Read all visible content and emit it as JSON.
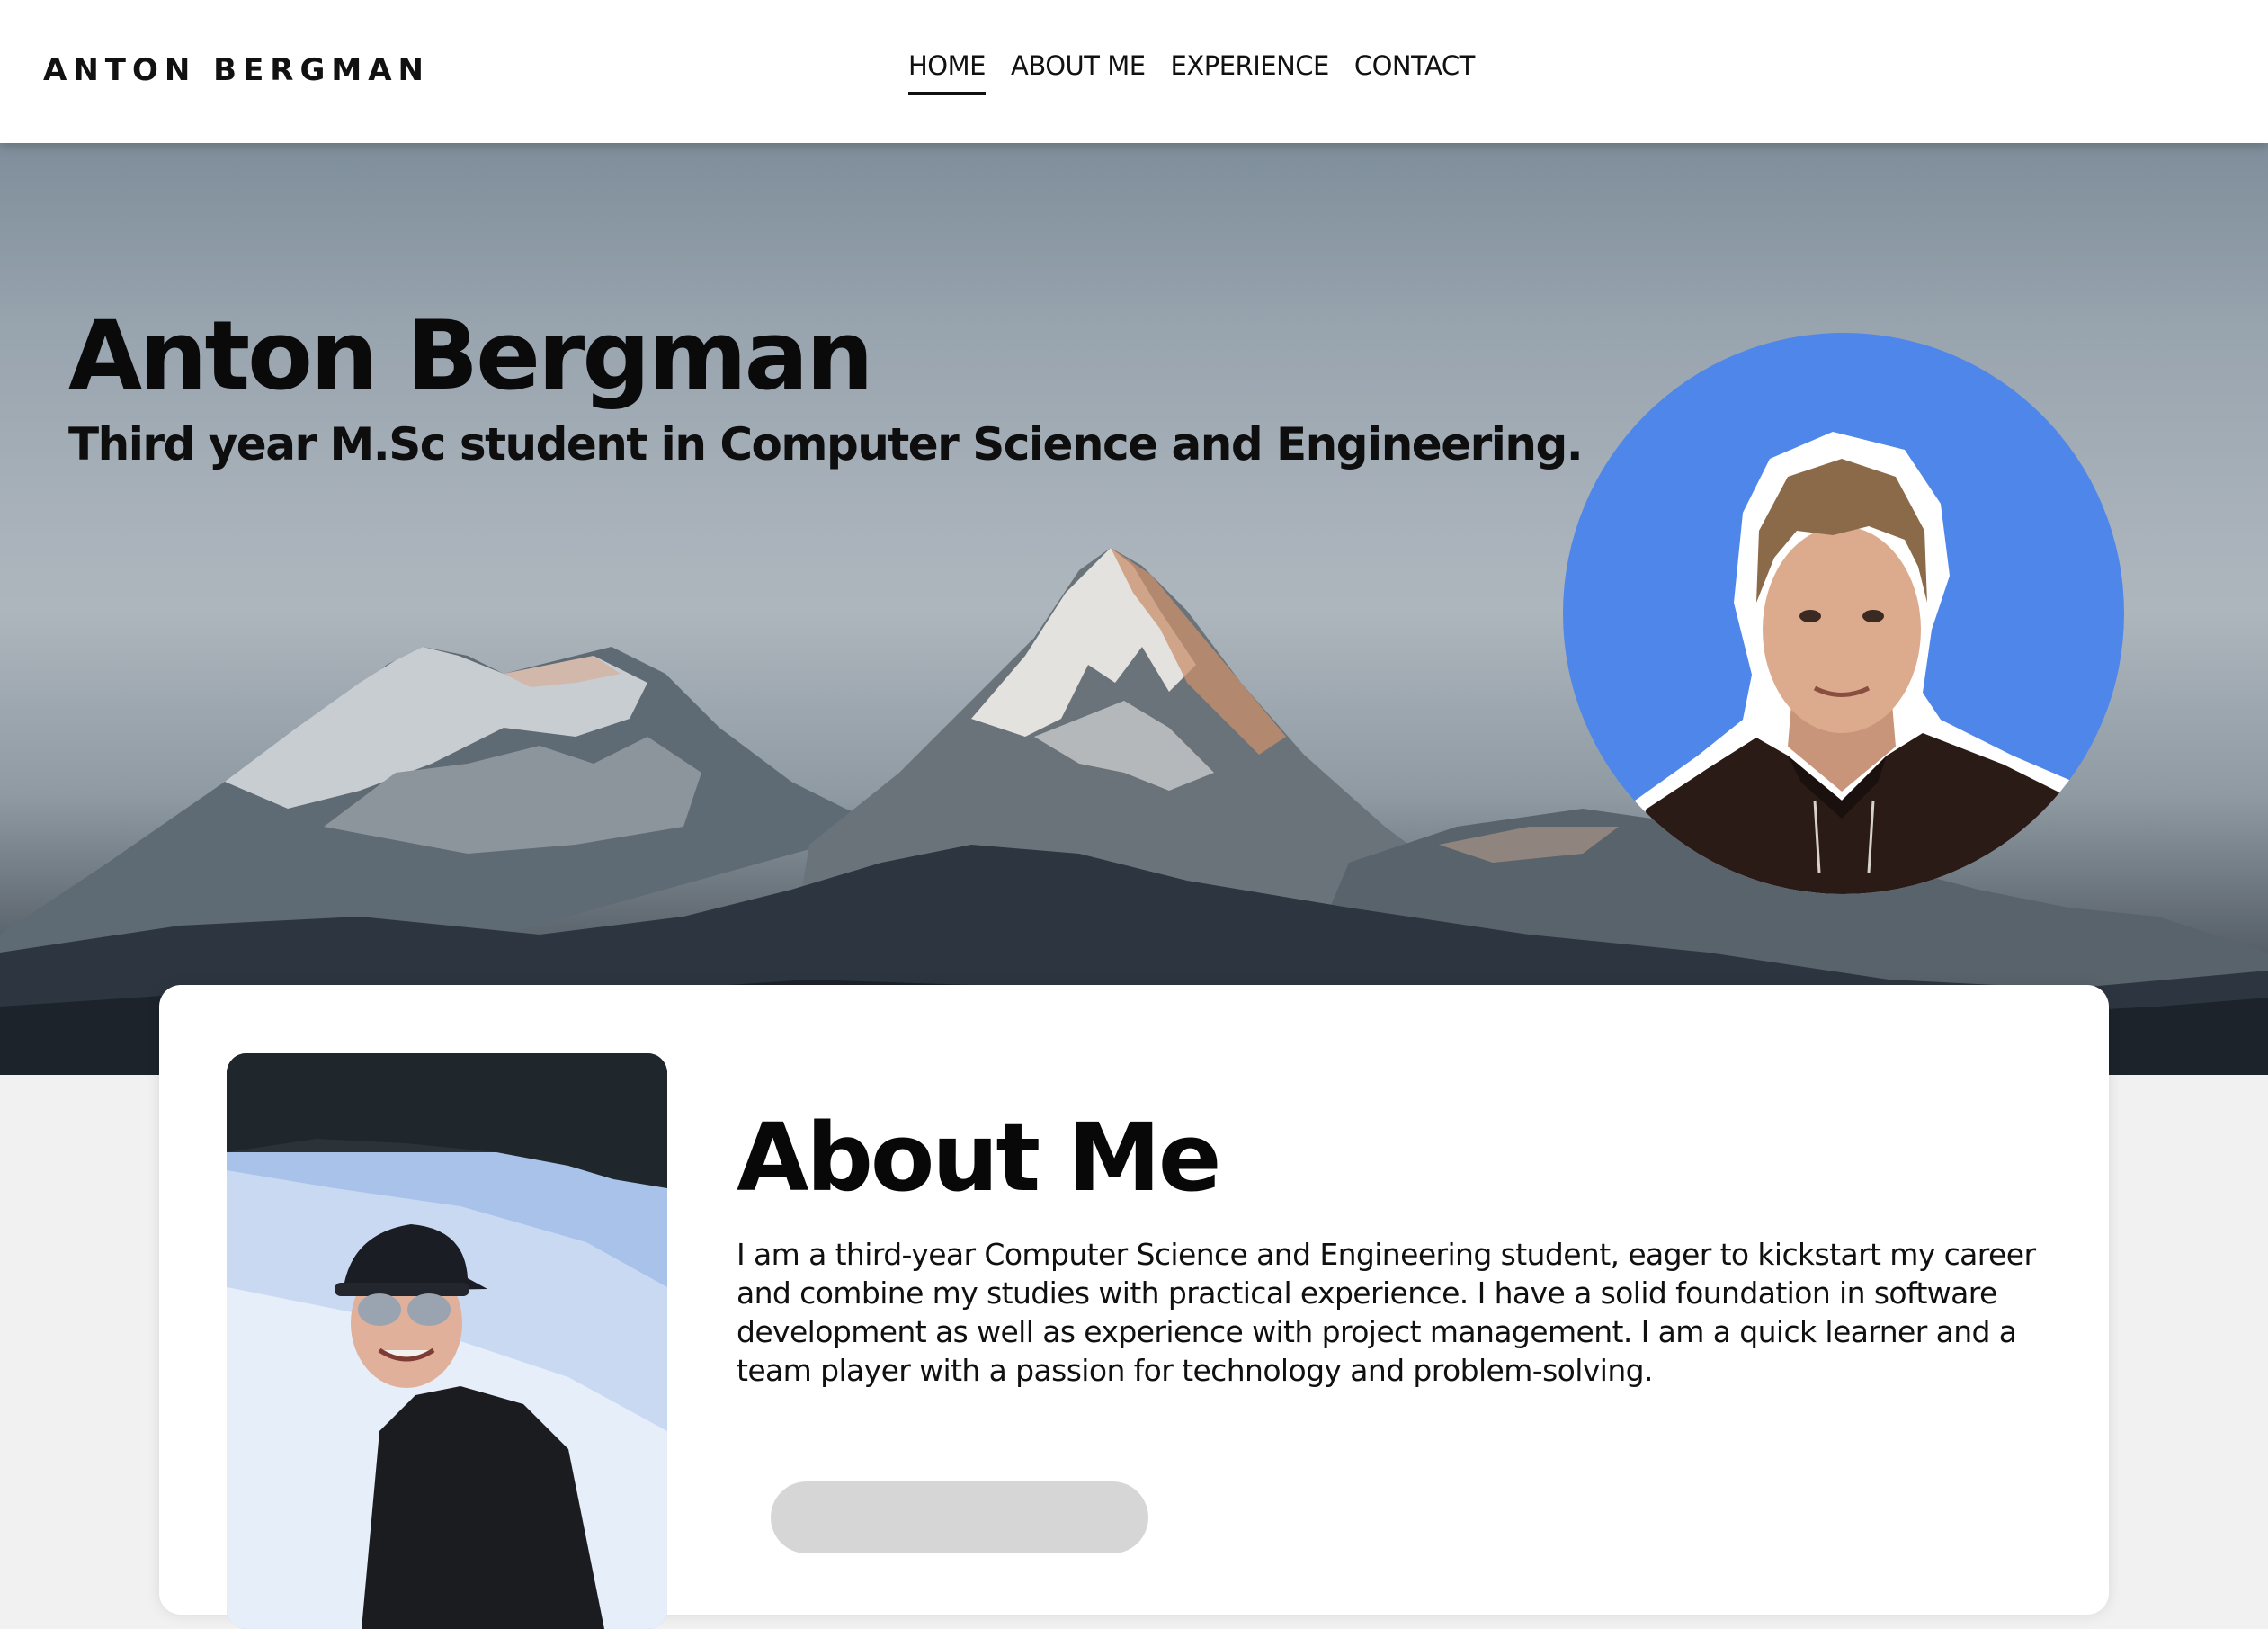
{
  "header": {
    "brand": "ANTON BERGMAN",
    "nav": [
      {
        "label": "HOME",
        "active": true
      },
      {
        "label": "ABOUT ME",
        "active": false
      },
      {
        "label": "EXPERIENCE",
        "active": false
      },
      {
        "label": "CONTACT",
        "active": false
      }
    ]
  },
  "hero": {
    "name": "Anton Bergman",
    "subtitle": "Third year M.Sc student in Computer Science and Engineering."
  },
  "about": {
    "title": "About Me",
    "text": "I am a third-year Computer Science and Engineering student, eager to kickstart my career and combine my studies with practical experience. I have a solid foundation in software development as well as experience with project management. I am a quick learner and a team player with a passion for technology and problem-solving."
  },
  "colors": {
    "avatar_background": "#4e86ea",
    "page_background": "#f1f1f1",
    "text": "#0b0b0b"
  }
}
